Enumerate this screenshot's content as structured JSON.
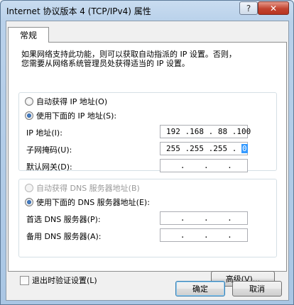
{
  "window": {
    "title": "Internet 协议版本 4 (TCP/IPv4) 属性",
    "help_label": "?",
    "close_label": "✕"
  },
  "tabs": [
    {
      "label": "常规"
    }
  ],
  "description": {
    "line1": "如果网络支持此功能，则可以获取自动指派的 IP 设置。否则，",
    "line2": "您需要从网络系统管理员处获得适当的 IP 设置。"
  },
  "ip_section": {
    "auto_label": "自动获得 IP 地址(O)",
    "manual_label": "使用下面的 IP 地址(S):",
    "selected": "manual",
    "ip_address": {
      "label": "IP 地址(I):",
      "value": "192 .168 . 88 .100"
    },
    "subnet_mask": {
      "label": "子网掩码(U):",
      "value": "255 .255 .255 . ",
      "cursor_value": "0"
    },
    "gateway": {
      "label": "默认网关(D):",
      "value": "   .    .    .   "
    }
  },
  "dns_section": {
    "auto_label": "自动获得 DNS 服务器地址(B)",
    "manual_label": "使用下面的 DNS 服务器地址(E):",
    "selected": "manual",
    "preferred": {
      "label": "首选 DNS 服务器(P):",
      "value": "   .    .    .   "
    },
    "alternate": {
      "label": "备用 DNS 服务器(A):",
      "value": "   .    .    .   "
    }
  },
  "validate_on_exit": {
    "label": "退出时验证设置(L)",
    "checked": false
  },
  "buttons": {
    "advanced": "高级(V)...",
    "ok": "确定",
    "cancel": "取消"
  }
}
